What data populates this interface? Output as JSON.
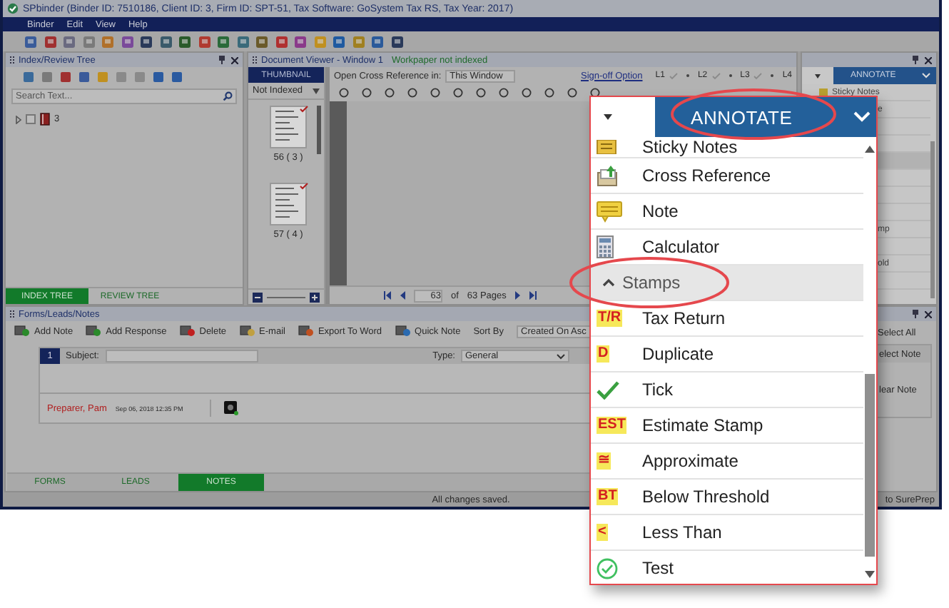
{
  "window": {
    "title": "SPbinder (Binder ID: 7510186, Client ID: 3, Firm ID: SPT-51, Tax Software: GoSystem Tax RS, Tax Year: 2017)"
  },
  "menu": [
    "Binder",
    "Edit",
    "View",
    "Help"
  ],
  "index_tree": {
    "title": "Index/Review Tree",
    "search": {
      "placeholder": "Search Text..."
    },
    "items": [
      {
        "label": "3",
        "checked": false
      }
    ],
    "tabs": [
      {
        "label": "INDEX TREE",
        "selected": true
      },
      {
        "label": "REVIEW TREE",
        "selected": false
      }
    ]
  },
  "document_viewer": {
    "title": "Document Viewer - Window 1",
    "status": "Workpaper not indexed",
    "thumbnail_tab": "THUMBNAIL",
    "filter": "Not Indexed",
    "thumbnails": [
      {
        "label": "56 ( 3 )",
        "checked": true
      },
      {
        "label": "57 ( 4 )",
        "checked": true
      }
    ],
    "open_label": "Open Cross Reference in:",
    "open_value": "This Window",
    "signoff_link": "Sign-off Option",
    "signoff_levels": [
      {
        "label": "L1",
        "checked": false
      },
      {
        "label": "L2",
        "checked": false
      },
      {
        "label": "L3",
        "checked": false
      },
      {
        "label": "L4"
      }
    ],
    "pager": {
      "page": "63",
      "of": "of",
      "total": "63 Pages"
    }
  },
  "annotate_panel": {
    "title": "ANNOTATE",
    "rows": [
      {
        "kind": "full",
        "label": "Sticky Notes",
        "selected": false
      },
      {
        "kind": "clipped",
        "label": "e",
        "selected": false
      },
      {
        "kind": "clipped",
        "selected": false
      },
      {
        "kind": "clipped",
        "selected": false
      },
      {
        "kind": "clipped",
        "selected": true
      },
      {
        "kind": "clipped",
        "selected": false
      },
      {
        "kind": "clipped",
        "selected": false
      },
      {
        "kind": "clipped",
        "selected": false
      },
      {
        "kind": "clipped",
        "label": "mp",
        "selected": false
      },
      {
        "kind": "clipped",
        "selected": false
      },
      {
        "kind": "clipped",
        "label": "old",
        "selected": false
      },
      {
        "kind": "clipped",
        "selected": false
      }
    ]
  },
  "notes": {
    "title": "Forms/Leads/Notes",
    "toolbar": [
      {
        "kind": "add-note",
        "label": "Add Note"
      },
      {
        "kind": "add-response",
        "label": "Add Response"
      },
      {
        "kind": "delete",
        "label": "Delete"
      },
      {
        "kind": "email",
        "label": "E-mail"
      },
      {
        "kind": "export",
        "label": "Export To Word"
      },
      {
        "kind": "quick-note",
        "label": "Quick Note"
      }
    ],
    "sort_label": "Sort By",
    "sort_value": "Created On Asc",
    "note": {
      "number": "1",
      "subject_label": "Subject:",
      "type_label": "Type:",
      "type_value": "General",
      "author": "Preparer, Pam",
      "date": "Sep 06, 2018 12:35 PM"
    },
    "tabs": [
      {
        "label": "FORMS",
        "selected": false
      },
      {
        "label": "LEADS",
        "selected": false
      },
      {
        "label": "NOTES",
        "selected": true
      }
    ]
  },
  "side_panel": {
    "select_all": "Select All",
    "select_note": "elect Note",
    "clear_note": "lear Note"
  },
  "status_bar": {
    "message": "All changes saved.",
    "right": "to SurePrep"
  },
  "popup": {
    "title": "ANNOTATE",
    "items": [
      {
        "kind": "sticky-notes",
        "label": "Sticky Notes"
      },
      {
        "kind": "cross-reference",
        "label": "Cross Reference"
      },
      {
        "kind": "note",
        "label": "Note"
      },
      {
        "kind": "calculator",
        "label": "Calculator"
      },
      {
        "kind": "group",
        "label": "Stamps",
        "expanded": true
      },
      {
        "kind": "badge",
        "badge": "T/R",
        "label": "Tax Return"
      },
      {
        "kind": "badge",
        "badge": "D",
        "label": "Duplicate"
      },
      {
        "kind": "tick",
        "label": "Tick"
      },
      {
        "kind": "badge",
        "badge": "EST",
        "label": "Estimate Stamp"
      },
      {
        "kind": "badge",
        "badge": "≅",
        "label": "Approximate"
      },
      {
        "kind": "badge",
        "badge": "BT",
        "label": "Below Threshold"
      },
      {
        "kind": "badge",
        "badge": "<",
        "label": "Less Than"
      },
      {
        "kind": "circle-tick",
        "label": "Test"
      }
    ]
  }
}
